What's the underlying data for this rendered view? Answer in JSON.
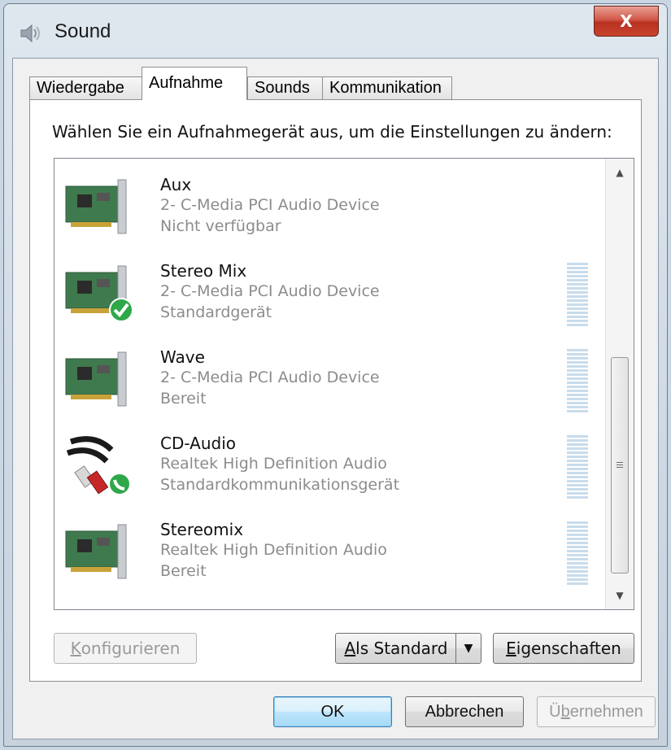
{
  "window": {
    "title": "Sound",
    "close_glyph": "X"
  },
  "tabs": [
    {
      "label": "Wiedergabe"
    },
    {
      "label": "Aufnahme"
    },
    {
      "label": "Sounds"
    },
    {
      "label": "Kommunikation"
    }
  ],
  "prompt": "Wählen Sie ein Aufnahmegerät aus, um die Einstellungen zu ändern:",
  "devices": [
    {
      "name": "Aux",
      "description": "2- C-Media PCI Audio Device",
      "status": "Nicht verfügbar",
      "icon": "sound-card-icon",
      "badge": ""
    },
    {
      "name": "Stereo Mix",
      "description": "2- C-Media PCI Audio Device",
      "status": "Standardgerät",
      "icon": "sound-card-icon",
      "badge": "default-check-icon"
    },
    {
      "name": "Wave",
      "description": "2- C-Media PCI Audio Device",
      "status": "Bereit",
      "icon": "sound-card-icon",
      "badge": ""
    },
    {
      "name": "CD-Audio",
      "description": "Realtek High Definition Audio",
      "status": "Standardkommunikationsgerät",
      "icon": "rca-cable-icon",
      "badge": "communication-phone-icon"
    },
    {
      "name": "Stereomix",
      "description": "Realtek High Definition Audio",
      "status": "Bereit",
      "icon": "sound-card-icon",
      "badge": ""
    }
  ],
  "buttons": {
    "configure": {
      "mnemonic": "K",
      "rest": "onfigurieren"
    },
    "set_default": {
      "mnemonic": "A",
      "rest": "ls Standard"
    },
    "properties": {
      "mnemonic": "E",
      "rest": "igenschaften"
    },
    "ok": "OK",
    "cancel": "Abbrechen",
    "apply": {
      "pre": "Ü",
      "mnemonic": "b",
      "rest": "ernehmen"
    }
  },
  "colors": {
    "title_close": "#c8452f",
    "meter": "#c8dcec",
    "disabled_text": "#9a9a9a"
  }
}
